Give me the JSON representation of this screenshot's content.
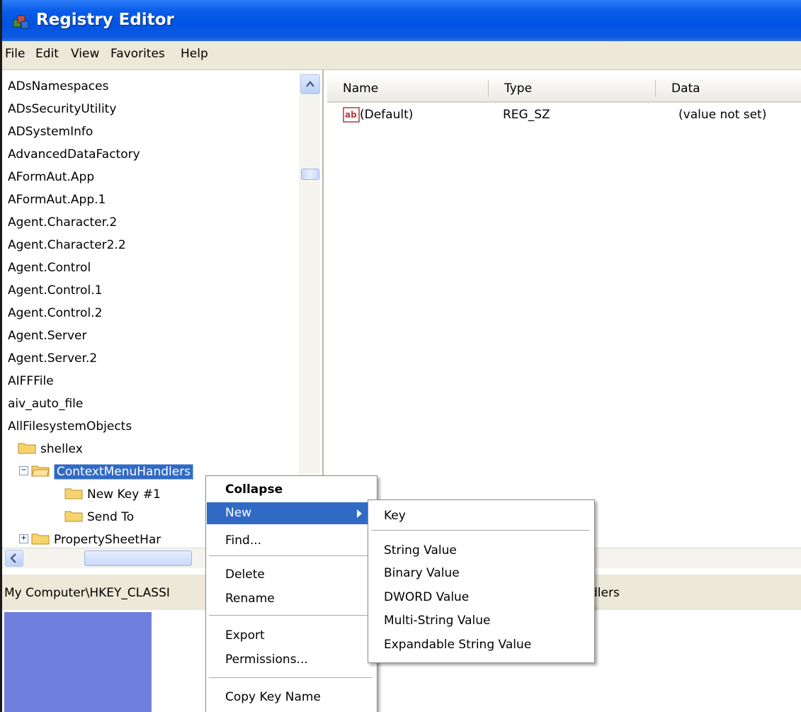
{
  "window": {
    "title": "Registry Editor"
  },
  "menubar": {
    "items": [
      "File",
      "Edit",
      "View",
      "Favorites",
      "Help"
    ]
  },
  "tree": {
    "items": [
      "ADsNamespaces",
      "ADsSecurityUtility",
      "ADSystemInfo",
      "AdvancedDataFactory",
      "AFormAut.App",
      "AFormAut.App.1",
      "Agent.Character.2",
      "Agent.Character2.2",
      "Agent.Control",
      "Agent.Control.1",
      "Agent.Control.2",
      "Agent.Server",
      "Agent.Server.2",
      "AIFFFile",
      "aiv_auto_file",
      "AllFilesystemObjects"
    ],
    "shellex": "shellex",
    "context_menu_handlers": "ContextMenuHandlers",
    "new_key": "New Key #1",
    "send_to": "Send To",
    "property_sheet": "PropertySheetHar"
  },
  "list": {
    "columns": [
      "Name",
      "Type",
      "Data"
    ],
    "rows": [
      {
        "name": "(Default)",
        "type": "REG_SZ",
        "data": "(value not set)"
      }
    ]
  },
  "status": {
    "path_left": "My Computer\\HKEY_CLASSI",
    "path_right": "dlers"
  },
  "context_menu": {
    "collapse": "Collapse",
    "new": "New",
    "find": "Find...",
    "delete": "Delete",
    "rename": "Rename",
    "export": "Export",
    "permissions": "Permissions...",
    "copy_key_name": "Copy Key Name"
  },
  "submenu": {
    "key": "Key",
    "string_value": "String Value",
    "binary_value": "Binary Value",
    "dword_value": "DWORD Value",
    "multi_string_value": "Multi-String Value",
    "expandable_string_value": "Expandable String Value"
  },
  "colors": {
    "title_bar": "#0053e2",
    "selection": "#316ac5",
    "chrome": "#ece9d8"
  },
  "icons": {
    "app": "registry-editor-icon",
    "folder": "folder-icon",
    "string_value": "ab-string-icon"
  }
}
